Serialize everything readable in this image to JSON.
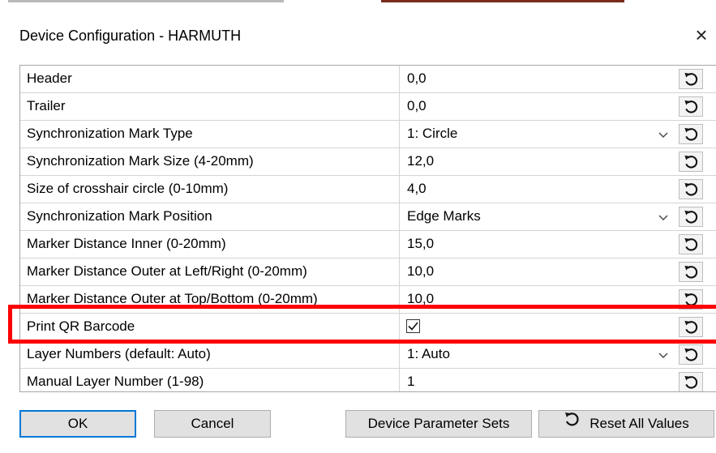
{
  "window": {
    "title": "Device Configuration - HARMUTH",
    "close_label": "×"
  },
  "grid": {
    "rows": [
      {
        "name": "Header",
        "value": "0,0",
        "type": "text"
      },
      {
        "name": "Trailer",
        "value": "0,0",
        "type": "text"
      },
      {
        "name": "Synchronization Mark Type",
        "value": "1: Circle",
        "type": "dropdown"
      },
      {
        "name": "Synchronization Mark Size (4-20mm)",
        "value": "12,0",
        "type": "text"
      },
      {
        "name": "Size of crosshair circle (0-10mm)",
        "value": "4,0",
        "type": "text"
      },
      {
        "name": "Synchronization Mark Position",
        "value": "Edge Marks",
        "type": "dropdown"
      },
      {
        "name": "Marker Distance Inner (0-20mm)",
        "value": "15,0",
        "type": "text"
      },
      {
        "name": "Marker Distance Outer at Left/Right (0-20mm)",
        "value": "10,0",
        "type": "text"
      },
      {
        "name": "Marker Distance Outer at Top/Bottom (0-20mm)",
        "value": "10,0",
        "type": "text"
      },
      {
        "name": "Print QR Barcode",
        "value": "",
        "checked": true,
        "type": "checkbox"
      },
      {
        "name": "Layer Numbers (default: Auto)",
        "value": "1: Auto",
        "type": "dropdown"
      },
      {
        "name": "Manual Layer Number (1-98)",
        "value": "1",
        "type": "text"
      }
    ],
    "reset_icon": "undo-arrow-icon"
  },
  "buttons": {
    "ok": "OK",
    "cancel": "Cancel",
    "device_parameter_sets": "Device Parameter Sets",
    "reset_all": "Reset All Values"
  },
  "highlight": {
    "color": "#ff0000"
  }
}
